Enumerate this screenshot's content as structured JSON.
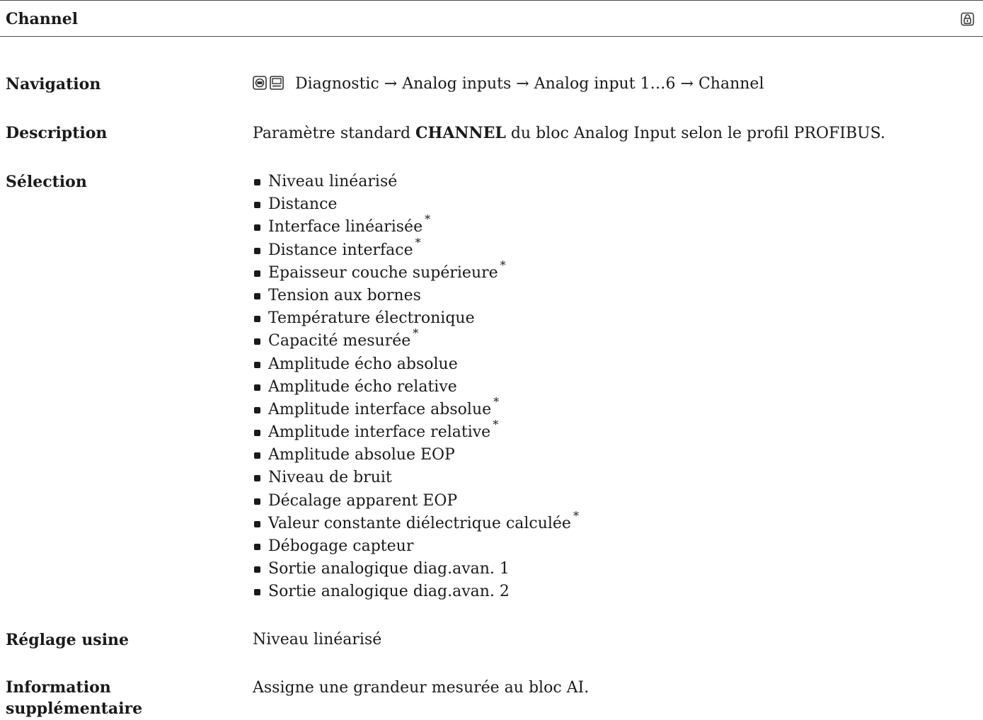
{
  "header": {
    "title": "Channel",
    "icon": "lock-icon"
  },
  "navigation": {
    "label": "Navigation",
    "icons": [
      "operating-display-icon",
      "display-icon"
    ],
    "path": "Diagnostic → Analog inputs → Analog input 1…6 → Channel"
  },
  "description": {
    "label": "Description",
    "prefix": "Paramètre standard ",
    "keyword": "CHANNEL",
    "suffix": " du bloc Analog Input selon le profil PROFIBUS."
  },
  "selection": {
    "label": "Sélection",
    "options": [
      {
        "text": "Niveau linéarisé",
        "star": ""
      },
      {
        "text": "Distance",
        "star": ""
      },
      {
        "text": "Interface linéarisée",
        "star": "*"
      },
      {
        "text": "Distance interface",
        "star": "*"
      },
      {
        "text": "Epaisseur couche supérieure",
        "star": "*"
      },
      {
        "text": "Tension aux bornes",
        "star": ""
      },
      {
        "text": "Température électronique",
        "star": ""
      },
      {
        "text": "Capacité mesurée",
        "star": "*"
      },
      {
        "text": "Amplitude écho absolue",
        "star": ""
      },
      {
        "text": "Amplitude écho relative",
        "star": ""
      },
      {
        "text": "Amplitude interface absolue",
        "star": "*"
      },
      {
        "text": "Amplitude interface relative",
        "star": "*"
      },
      {
        "text": "Amplitude absolue EOP",
        "star": ""
      },
      {
        "text": "Niveau de bruit",
        "star": ""
      },
      {
        "text": "Décalage apparent EOP",
        "star": ""
      },
      {
        "text": "Valeur constante diélectrique calculée",
        "star": "*"
      },
      {
        "text": "Débogage capteur",
        "star": ""
      },
      {
        "text": "Sortie analogique diag.avan. 1",
        "star": ""
      },
      {
        "text": "Sortie analogique diag.avan. 2",
        "star": ""
      }
    ]
  },
  "factory_setting": {
    "label": "Réglage usine",
    "value": "Niveau linéarisé"
  },
  "additional_info": {
    "label_line1": "Information",
    "label_line2": "supplémentaire",
    "value": "Assigne une grandeur mesurée au bloc AI."
  }
}
